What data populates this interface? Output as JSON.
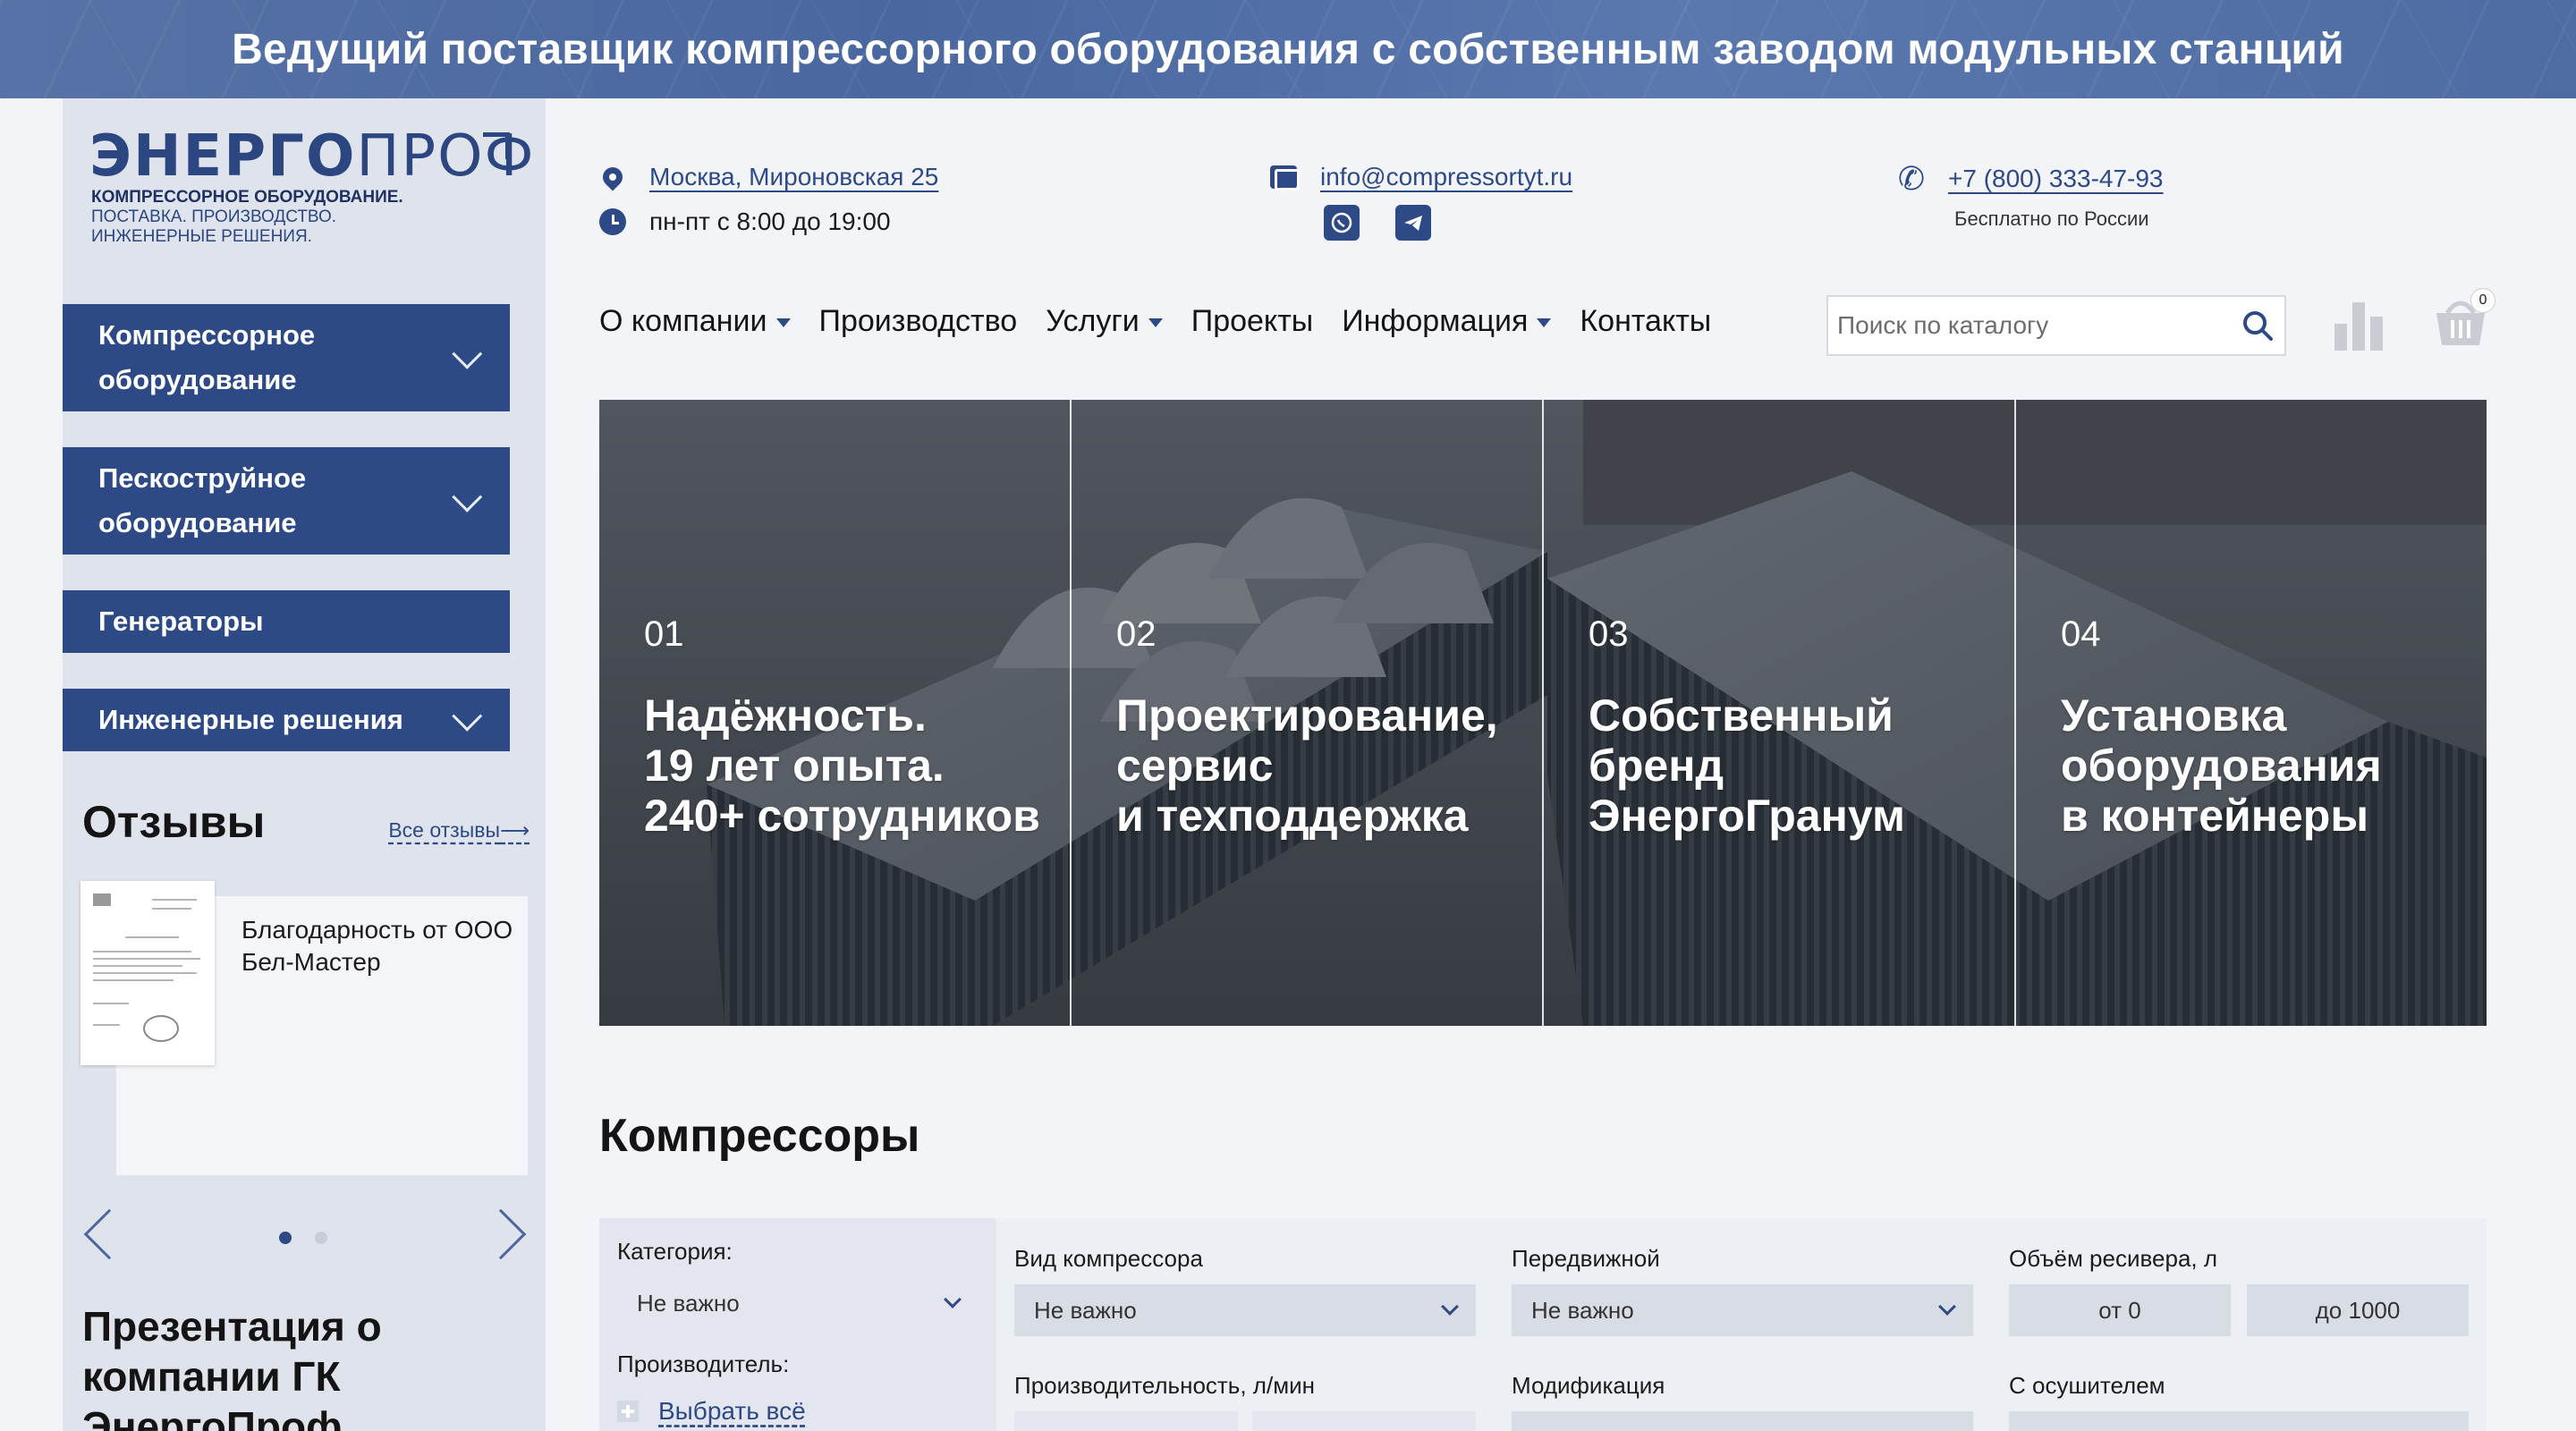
{
  "banner": {
    "title": "Ведущий поставщик компрессорного оборудования с собственным заводом модульных станций"
  },
  "logo": {
    "name_bold": "ЭНЕРГО",
    "name_thin": "ПРОФ",
    "tagline_1": "КОМПРЕССОРНОЕ ОБОРУДОВАНИЕ.",
    "tagline_2": "ПОСТАВКА. ПРОИЗВОДСТВО.",
    "tagline_3": "ИНЖЕНЕРНЫЕ РЕШЕНИЯ."
  },
  "sidebar": {
    "menu": [
      {
        "label": "Компрессорное\nоборудование"
      },
      {
        "label": "Пескоструйное\nоборудование"
      },
      {
        "label": "Генераторы"
      },
      {
        "label": "Инженерные решения"
      }
    ],
    "reviews_title": "Отзывы",
    "reviews_all": "Все отзывы",
    "review_text": "Благодарность от ООО Бел-Мастер",
    "presentation": "Презентация о компании ГК ЭнергоПроф"
  },
  "header": {
    "address": "Москва, Мироновская 25",
    "hours": "пн-пт с 8:00 до 19:00",
    "email": "info@compressortyt.ru",
    "phone": "+7 (800) 333-47-93",
    "phone_note": "Бесплатно по России"
  },
  "nav": [
    {
      "label": "О компании",
      "dropdown": true
    },
    {
      "label": "Производство",
      "dropdown": false
    },
    {
      "label": "Услуги",
      "dropdown": true
    },
    {
      "label": "Проекты",
      "dropdown": false
    },
    {
      "label": "Информация",
      "dropdown": true
    },
    {
      "label": "Контакты",
      "dropdown": false
    }
  ],
  "search": {
    "placeholder": "Поиск по каталогу"
  },
  "cart": {
    "count": "0"
  },
  "hero": [
    {
      "num": "01",
      "text": "Надёжность.\n19 лет опыта.\n240+ сотрудников"
    },
    {
      "num": "02",
      "text": "Проектирование,\nсервис\nи техподдержка"
    },
    {
      "num": "03",
      "text": "Собственный\nбренд\nЭнергоГранум"
    },
    {
      "num": "04",
      "text": "Установка\nоборудования\nв контейнеры"
    }
  ],
  "compressors": {
    "title": "Компрессоры",
    "category_label": "Категория:",
    "category_value": "Не важно",
    "producer_label": "Производитель:",
    "select_all": "Выбрать всё",
    "type_label": "Вид компрессора",
    "type_value": "Не важно",
    "mobile_label": "Передвижной",
    "mobile_value": "Не важно",
    "receiver_label": "Объём ресивера, л",
    "receiver_from": "от 0",
    "receiver_to": "до 1000",
    "capacity_label": "Производительность, л/мин",
    "modification_label": "Модификация",
    "dryer_label": "С осушителем"
  },
  "colors": {
    "brand": "#2d4a86",
    "banner": "#4e6ba2",
    "background": "#f3f4f7"
  }
}
